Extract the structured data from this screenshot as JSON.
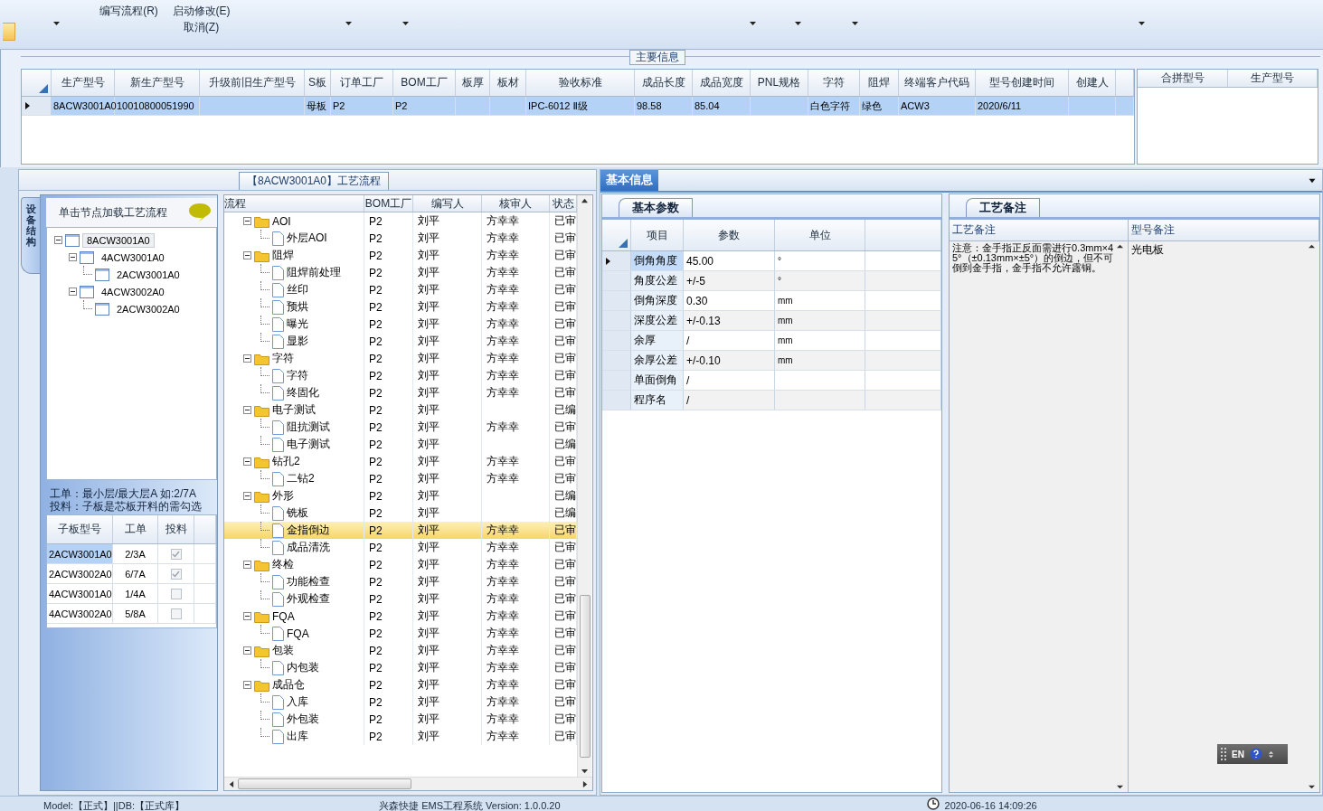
{
  "toolbar": {
    "groups": [
      [
        "编写流程(R)"
      ],
      [
        "启动修改(E)",
        "取消(Z)"
      ]
    ]
  },
  "main_info": {
    "title": "主要信息",
    "columns": [
      "生产型号",
      "新生产型号",
      "升级前旧生产型号",
      "S板",
      "订单工厂",
      "BOM工厂",
      "板厚",
      "板材",
      "验收标准",
      "成品长度",
      "成品宽度",
      "PNL规格",
      "字符",
      "阻焊",
      "终端客户代码",
      "型号创建时间",
      "创建人"
    ],
    "rows": [
      {
        "selected": true,
        "cells": [
          "8ACW3001A0",
          "10010800051990",
          null,
          "母板",
          "P2",
          "P2",
          null,
          null,
          "IPC-6012 Ⅱ级",
          "98.58",
          "85.04",
          null,
          "白色字符",
          "绿色",
          "ACW3",
          "2020/6/11",
          null
        ]
      }
    ],
    "merge_table": {
      "columns": [
        "合拼型号",
        "生产型号"
      ]
    }
  },
  "process_panel": {
    "tab": "【8ACW3001A0】工艺流程",
    "side_tab": "设备结构",
    "structure_hint": "单击节点加载工艺流程",
    "structure_tree": [
      {
        "label": "8ACW3001A0",
        "selected": true,
        "expanded": true,
        "children": [
          {
            "label": "4ACW3001A0",
            "selected": false,
            "expanded": true,
            "children": [
              {
                "label": "2ACW3001A0",
                "selected": false
              }
            ]
          },
          {
            "label": "4ACW3002A0",
            "selected": false,
            "expanded": true,
            "children": [
              {
                "label": "2ACW3002A0",
                "selected": false
              }
            ]
          }
        ]
      }
    ],
    "notes": [
      "工单：最小层/最大层A 如:2/7A",
      "投料：子板是芯板开料的需勾选"
    ],
    "sub_boards": {
      "columns": [
        "子板型号",
        "工单",
        "投料"
      ],
      "rows": [
        {
          "model": "2ACW3001A0",
          "order": "2/3A",
          "feed": true,
          "selected": true
        },
        {
          "model": "2ACW3002A0",
          "order": "6/7A",
          "feed": true,
          "selected": false
        },
        {
          "model": "4ACW3001A0",
          "order": "1/4A",
          "feed": false,
          "selected": false
        },
        {
          "model": "4ACW3002A0",
          "order": "5/8A",
          "feed": false,
          "selected": false
        }
      ]
    },
    "flow": {
      "columns": [
        "流程",
        "BOM工厂",
        "编写人",
        "核审人",
        "状态"
      ],
      "groups": [
        {
          "name": "AOI",
          "bom": "P2",
          "writer": "刘平",
          "reviewer": "方幸幸",
          "status": "已审",
          "expanded": true,
          "selected": false,
          "children": [
            {
              "name": "外层AOI",
              "bom": "P2",
              "writer": "刘平",
              "reviewer": "方幸幸",
              "status": "已审",
              "selected": false
            }
          ]
        },
        {
          "name": "阻焊",
          "bom": "P2",
          "writer": "刘平",
          "reviewer": "方幸幸",
          "status": "已审",
          "expanded": true,
          "selected": false,
          "children": [
            {
              "name": "阻焊前处理",
              "bom": "P2",
              "writer": "刘平",
              "reviewer": "方幸幸",
              "status": "已审",
              "selected": false
            },
            {
              "name": "丝印",
              "bom": "P2",
              "writer": "刘平",
              "reviewer": "方幸幸",
              "status": "已审",
              "selected": false
            },
            {
              "name": "预烘",
              "bom": "P2",
              "writer": "刘平",
              "reviewer": "方幸幸",
              "status": "已审",
              "selected": false
            },
            {
              "name": "曝光",
              "bom": "P2",
              "writer": "刘平",
              "reviewer": "方幸幸",
              "status": "已审",
              "selected": false
            },
            {
              "name": "显影",
              "bom": "P2",
              "writer": "刘平",
              "reviewer": "方幸幸",
              "status": "已审",
              "selected": false
            }
          ]
        },
        {
          "name": "字符",
          "bom": "P2",
          "writer": "刘平",
          "reviewer": "方幸幸",
          "status": "已审",
          "expanded": true,
          "selected": false,
          "children": [
            {
              "name": "字符",
              "bom": "P2",
              "writer": "刘平",
              "reviewer": "方幸幸",
              "status": "已审",
              "selected": false
            },
            {
              "name": "终固化",
              "bom": "P2",
              "writer": "刘平",
              "reviewer": "方幸幸",
              "status": "已审",
              "selected": false
            }
          ]
        },
        {
          "name": "电子测试",
          "bom": "P2",
          "writer": "刘平",
          "status": "已编",
          "expanded": true,
          "selected": false,
          "children": [
            {
              "name": "阻抗测试",
              "bom": "P2",
              "writer": "刘平",
              "reviewer": "方幸幸",
              "status": "已审",
              "selected": false
            },
            {
              "name": "电子测试",
              "bom": "P2",
              "writer": "刘平",
              "status": "已编",
              "selected": false
            }
          ]
        },
        {
          "name": "钻孔2",
          "bom": "P2",
          "writer": "刘平",
          "reviewer": "方幸幸",
          "status": "已审",
          "expanded": true,
          "selected": false,
          "children": [
            {
              "name": "二钻2",
              "bom": "P2",
              "writer": "刘平",
              "reviewer": "方幸幸",
              "status": "已审",
              "selected": false
            }
          ]
        },
        {
          "name": "外形",
          "bom": "P2",
          "writer": "刘平",
          "status": "已编",
          "expanded": true,
          "selected": false,
          "children": [
            {
              "name": "铣板",
              "bom": "P2",
              "writer": "刘平",
              "status": "已编",
              "selected": false
            },
            {
              "name": "金指倒边",
              "bom": "P2",
              "writer": "刘平",
              "reviewer": "方幸幸",
              "status": "已审",
              "selected": true
            },
            {
              "name": "成品清洗",
              "bom": "P2",
              "writer": "刘平",
              "reviewer": "方幸幸",
              "status": "已审",
              "selected": false
            }
          ]
        },
        {
          "name": "终检",
          "bom": "P2",
          "writer": "刘平",
          "reviewer": "方幸幸",
          "status": "已审",
          "expanded": true,
          "selected": false,
          "children": [
            {
              "name": "功能检查",
              "bom": "P2",
              "writer": "刘平",
              "reviewer": "方幸幸",
              "status": "已审",
              "selected": false
            },
            {
              "name": "外观检查",
              "bom": "P2",
              "writer": "刘平",
              "reviewer": "方幸幸",
              "status": "已审",
              "selected": false
            }
          ]
        },
        {
          "name": "FQA",
          "bom": "P2",
          "writer": "刘平",
          "reviewer": "方幸幸",
          "status": "已审",
          "expanded": true,
          "selected": false,
          "children": [
            {
              "name": "FQA",
              "bom": "P2",
              "writer": "刘平",
              "reviewer": "方幸幸",
              "status": "已审",
              "selected": false
            }
          ]
        },
        {
          "name": "包装",
          "bom": "P2",
          "writer": "刘平",
          "reviewer": "方幸幸",
          "status": "已审",
          "expanded": true,
          "selected": false,
          "children": [
            {
              "name": "内包装",
              "bom": "P2",
              "writer": "刘平",
              "reviewer": "方幸幸",
              "status": "已审",
              "selected": false
            }
          ]
        },
        {
          "name": "成品仓",
          "bom": "P2",
          "writer": "刘平",
          "reviewer": "方幸幸",
          "status": "已审",
          "expanded": true,
          "selected": false,
          "children": [
            {
              "name": "入库",
              "bom": "P2",
              "writer": "刘平",
              "reviewer": "方幸幸",
              "status": "已审",
              "selected": false
            },
            {
              "name": "外包装",
              "bom": "P2",
              "writer": "刘平",
              "reviewer": "方幸幸",
              "status": "已审",
              "selected": false
            },
            {
              "name": "出库",
              "bom": "P2",
              "writer": "刘平",
              "reviewer": "方幸幸",
              "status": "已审",
              "selected": false
            }
          ]
        }
      ]
    }
  },
  "info_panel": {
    "tab": "基本信息",
    "params": {
      "tab": "基本参数",
      "columns": [
        "项目",
        "参数",
        "单位"
      ],
      "rows": [
        {
          "item": "倒角角度",
          "value": "45.00",
          "unit": "°",
          "selected": true
        },
        {
          "item": "角度公差",
          "value": "+/-5",
          "unit": "°",
          "selected": false
        },
        {
          "item": "倒角深度",
          "value": "0.30",
          "unit": "mm",
          "selected": false
        },
        {
          "item": "深度公差",
          "value": "+/-0.13",
          "unit": "mm",
          "selected": false
        },
        {
          "item": "余厚",
          "value": "/",
          "unit": "mm",
          "selected": false
        },
        {
          "item": "余厚公差",
          "value": "+/-0.10",
          "unit": "mm",
          "selected": false
        },
        {
          "item": "单面倒角",
          "value": "/",
          "selected": false
        },
        {
          "item": "程序名",
          "value": "/",
          "selected": false
        }
      ]
    },
    "remarks": {
      "tab": "工艺备注",
      "columns": [
        "工艺备注",
        "型号备注"
      ],
      "process_note": "注意：金手指正反面需进行0.3mm×45°（±0.13mm×±5°）的倒边，但不可倒到金手指，金手指不允许露铜。",
      "model_note": "光电板"
    }
  },
  "language_bar": {
    "label": "EN"
  },
  "status_bar": {
    "model": "Model:【正式】||DB:【正式库】",
    "system": "兴森快捷 EMS工程系统 Version: 1.0.0.20",
    "time": "2020-06-16 14:09:26"
  }
}
